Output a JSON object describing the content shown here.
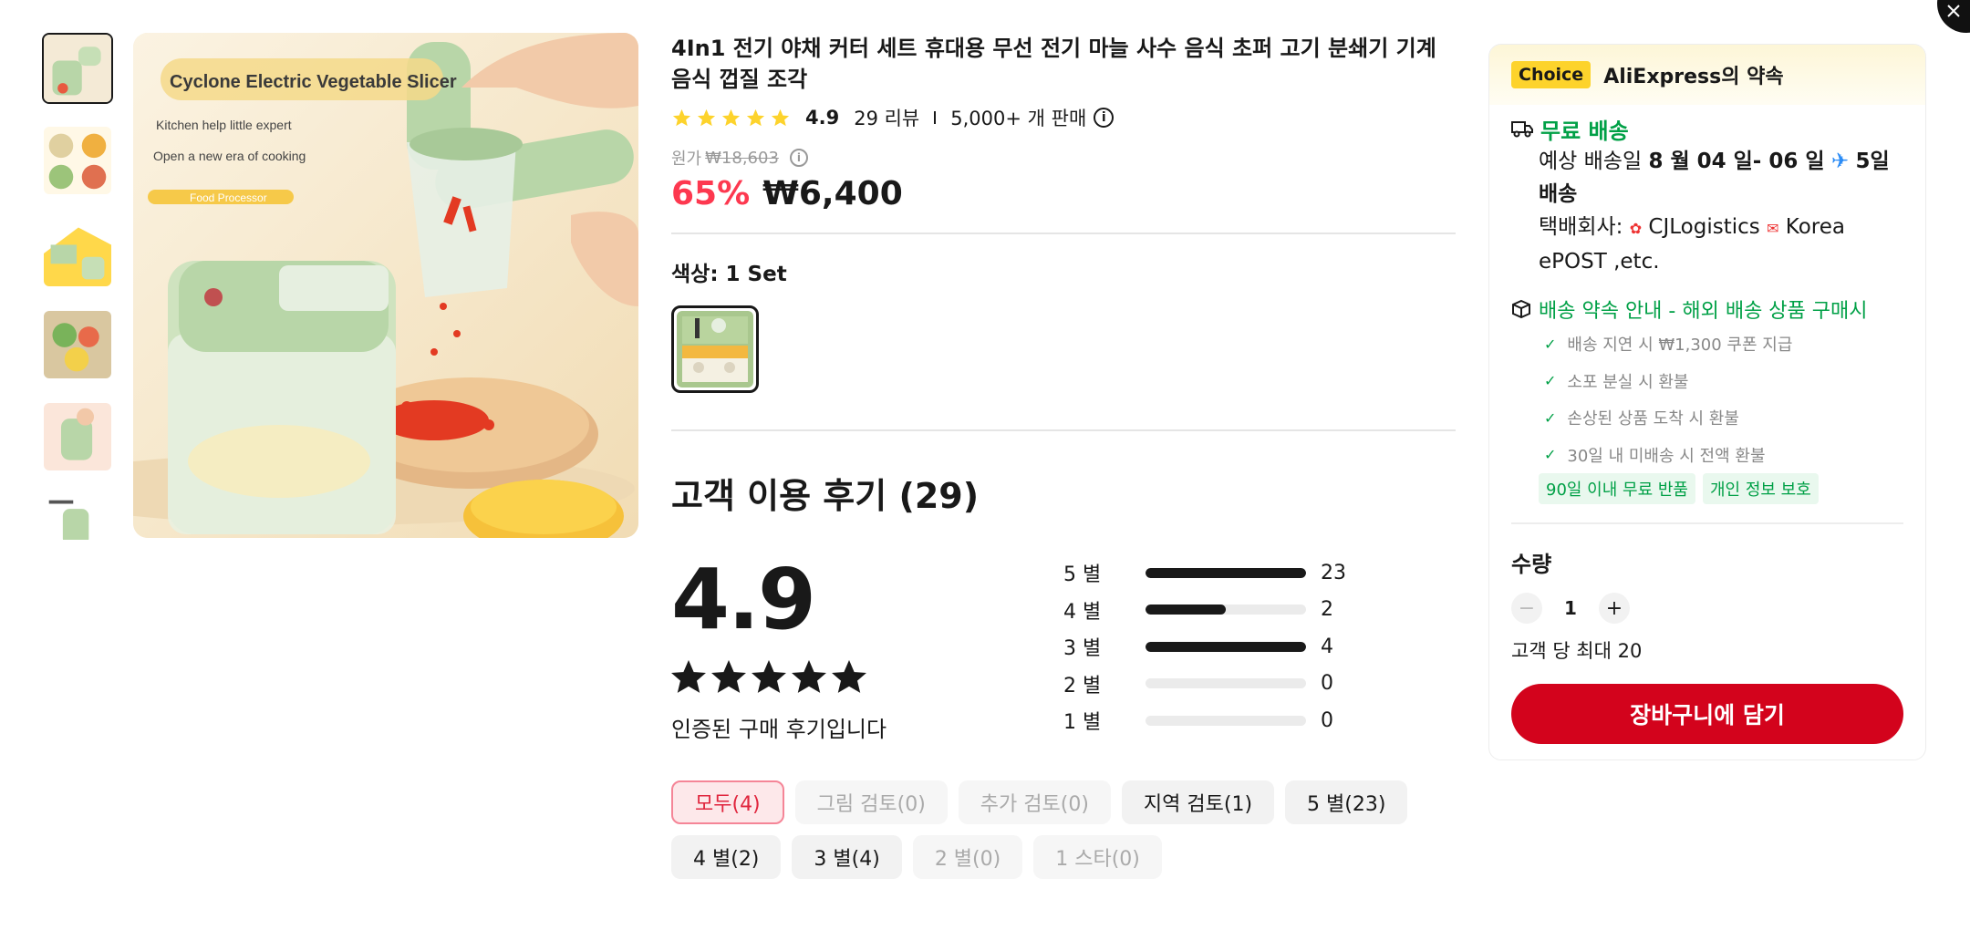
{
  "product": {
    "title": "4In1 전기 야채 커터 세트 휴대용 무선 전기 마늘 사수 음식 초퍼 고기 분쇄기 기계 음식 껍질 조각",
    "rating": "4.9",
    "reviews_link": "29 리뷰",
    "sold": "5,000+ 개 판매",
    "info_icon": "info-icon",
    "original_label": "원가",
    "original_price": "₩18,603",
    "discount": "65%",
    "price": "₩6,400",
    "color_label": "색상: 1 Set"
  },
  "image": {
    "overlay_title": "Cyclone Electric Vegetable Slicer",
    "line1": "Kitchen help little expert",
    "line2": "Open a new era of cooking",
    "badge": "Food Processor"
  },
  "reviews": {
    "title": "고객 이용 후기 (29)",
    "score": "4.9",
    "score_value": 4.9,
    "verified": "인증된 구매 후기입니다",
    "distribution": [
      {
        "label": "5 별",
        "count": "23",
        "fraction": 1.0
      },
      {
        "label": "4 별",
        "count": "2",
        "fraction": 0.5
      },
      {
        "label": "3 별",
        "count": "4",
        "fraction": 1.0
      },
      {
        "label": "2 별",
        "count": "0",
        "fraction": 0
      },
      {
        "label": "1 별",
        "count": "0",
        "fraction": 0
      }
    ],
    "filters": [
      {
        "label": "모두(4)",
        "state": "active"
      },
      {
        "label": "그림 검토(0)",
        "state": "disabled"
      },
      {
        "label": "추가 검토(0)",
        "state": "disabled"
      },
      {
        "label": "지역 검토(1)",
        "state": "normal"
      },
      {
        "label": "5 별(23)",
        "state": "normal"
      },
      {
        "label": "4 별(2)",
        "state": "normal"
      },
      {
        "label": "3 별(4)",
        "state": "normal"
      },
      {
        "label": "2 별(0)",
        "state": "disabled"
      },
      {
        "label": "1 스타(0)",
        "state": "disabled"
      }
    ]
  },
  "panel": {
    "badge": "Choice",
    "promise": "AliExpress의 약속",
    "free_shipping": "무료 배송",
    "delivery_prefix": "예상 배송일",
    "delivery_dates": "8 월 04 일- 06 일",
    "delivery_days": "5일",
    "delivery_suffix": "배송",
    "carrier_label": "택배회사:",
    "carrier1": "CJLogistics",
    "carrier2": "Korea ePOST ,etc.",
    "protection_title": "배송 약속 안내 - 해외 배송 상품 구매시",
    "protection_items": [
      "배송 지연 시 ₩1,300 쿠폰 지급",
      "소포 분실 시 환불",
      "손상된 상품 도착 시 환불",
      "30일 내 미배송 시 전액 환불"
    ],
    "tags": [
      "90일 이내 무료 반품",
      "개인 정보 보호"
    ],
    "qty_label": "수량",
    "qty_value": "1",
    "max_qty": "고객 당 최대 20",
    "cart_button": "장바구니에 담기"
  },
  "colors": {
    "accent_red": "#fd384f",
    "cart_red": "#d3031c",
    "green": "#00a046",
    "star": "#fdd32c",
    "choice_yellow": "#fdd32c"
  }
}
